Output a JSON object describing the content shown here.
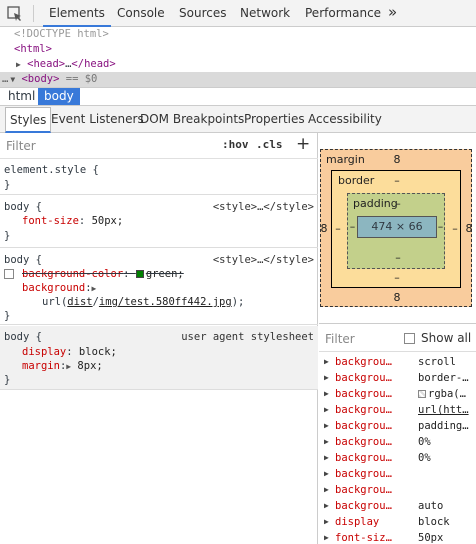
{
  "main_tabs": [
    "Elements",
    "Console",
    "Sources",
    "Network",
    "Performance"
  ],
  "more_tabs": "»",
  "dom_tree": {
    "doctype": "<!DOCTYPE html>",
    "html": "<html>",
    "head_open": "<head>",
    "head_ellipsis": "…",
    "head_close": "</head>",
    "body_prefix": "…",
    "body": "<body>",
    "body_suffix": "== $0"
  },
  "breadcrumb": [
    "html",
    "body"
  ],
  "sub_tabs": [
    "Styles",
    "Event Listeners",
    "DOM Breakpoints",
    "Properties",
    "Accessibility"
  ],
  "styles_toolbar": {
    "filter_placeholder": "Filter",
    "hov": ":hov",
    "cls": ".cls",
    "add": "+"
  },
  "rules": {
    "element_style": {
      "selector": "element.style {",
      "close": "}"
    },
    "rule1": {
      "selector": "body {",
      "source": "<style>…</style>",
      "prop": "font-size",
      "value": "50px;",
      "close": "}"
    },
    "rule2": {
      "selector": "body {",
      "source": "<style>…</style>",
      "prop1": "background-color",
      "value1": "green;",
      "prop2": "background",
      "value2_prefix": "url(",
      "value2_link1": "dist",
      "value2_sep": "/",
      "value2_link2": "img/test.580ff442.jpg",
      "value2_suffix": ");",
      "close": "}"
    },
    "rule3": {
      "selector": "body {",
      "source": "user agent stylesheet",
      "prop1": "display",
      "value1": "block;",
      "prop2": "margin",
      "value2": "8px;",
      "close": "}"
    }
  },
  "box_model": {
    "margin_label": "margin",
    "margin_top": "8",
    "margin_bottom": "8",
    "margin_left": "8",
    "margin_right": "8",
    "border_label": "border",
    "border_top": "–",
    "border_bottom": "–",
    "border_left": "–",
    "border_right": "–",
    "padding_label": "padding",
    "padding_top": "–",
    "padding_bottom": "–",
    "padding_left": "–",
    "padding_right": "–",
    "content": "474 × 66"
  },
  "computed": {
    "filter_placeholder": "Filter",
    "show_all": "Show all",
    "rows": [
      {
        "prop": "backgrou…",
        "value": "scroll"
      },
      {
        "prop": "backgrou…",
        "value": "border-…"
      },
      {
        "prop": "backgrou…",
        "value": "rgba(…"
      },
      {
        "prop": "backgrou…",
        "value": "url(htt…"
      },
      {
        "prop": "backgrou…",
        "value": "padding…"
      },
      {
        "prop": "backgrou…",
        "value": "0%"
      },
      {
        "prop": "backgrou…",
        "value": "0%"
      },
      {
        "prop": "backgrou…",
        "value": ""
      },
      {
        "prop": "backgrou…",
        "value": ""
      },
      {
        "prop": "backgrou…",
        "value": "auto"
      },
      {
        "prop": "display",
        "value": "block"
      },
      {
        "prop": "font-siz…",
        "value": "50px"
      }
    ]
  }
}
